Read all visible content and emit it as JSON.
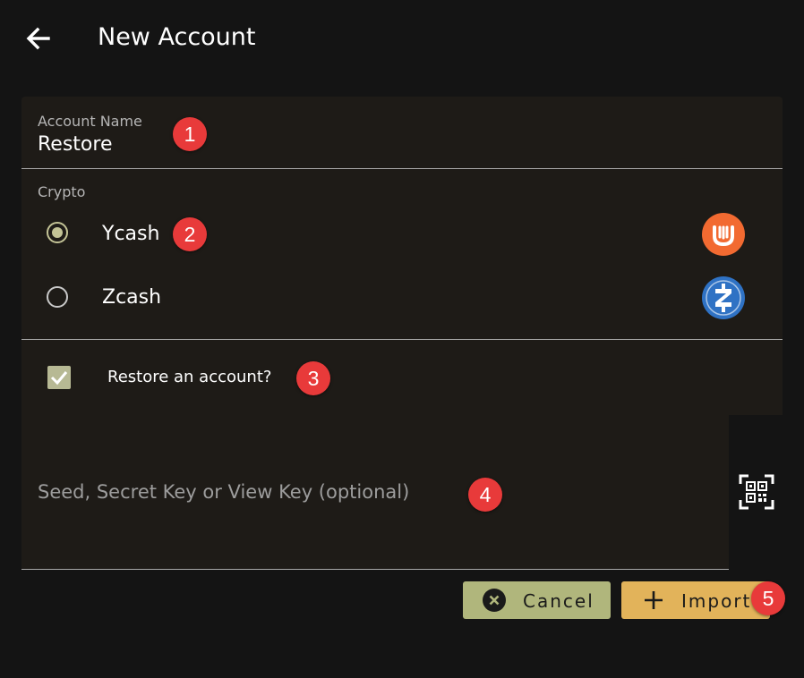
{
  "header": {
    "title": "New Account",
    "back_icon": "arrow-left-icon"
  },
  "account_name": {
    "label": "Account Name",
    "value": "Restore"
  },
  "crypto": {
    "label": "Crypto",
    "options": [
      {
        "label": "Ycash",
        "selected": true,
        "logo": "ycash-logo",
        "logo_color": "#f26a31"
      },
      {
        "label": "Zcash",
        "selected": false,
        "logo": "zcash-logo",
        "logo_color": "#2f72c4"
      }
    ]
  },
  "restore": {
    "label": "Restore an account?",
    "checked": true
  },
  "seed": {
    "placeholder": "Seed, Secret Key or View Key (optional)",
    "value": "",
    "scan_icon": "qr-scan-icon"
  },
  "actions": {
    "cancel_label": "Cancel",
    "import_label": "Import",
    "cancel_color": "#b0b67c",
    "import_color": "#e2b35a"
  },
  "annotations": [
    "1",
    "2",
    "3",
    "4",
    "5"
  ],
  "theme": {
    "background": "#141414",
    "card": "#1e1b17",
    "accent": "#c3c396",
    "badge": "#e83a3a"
  }
}
